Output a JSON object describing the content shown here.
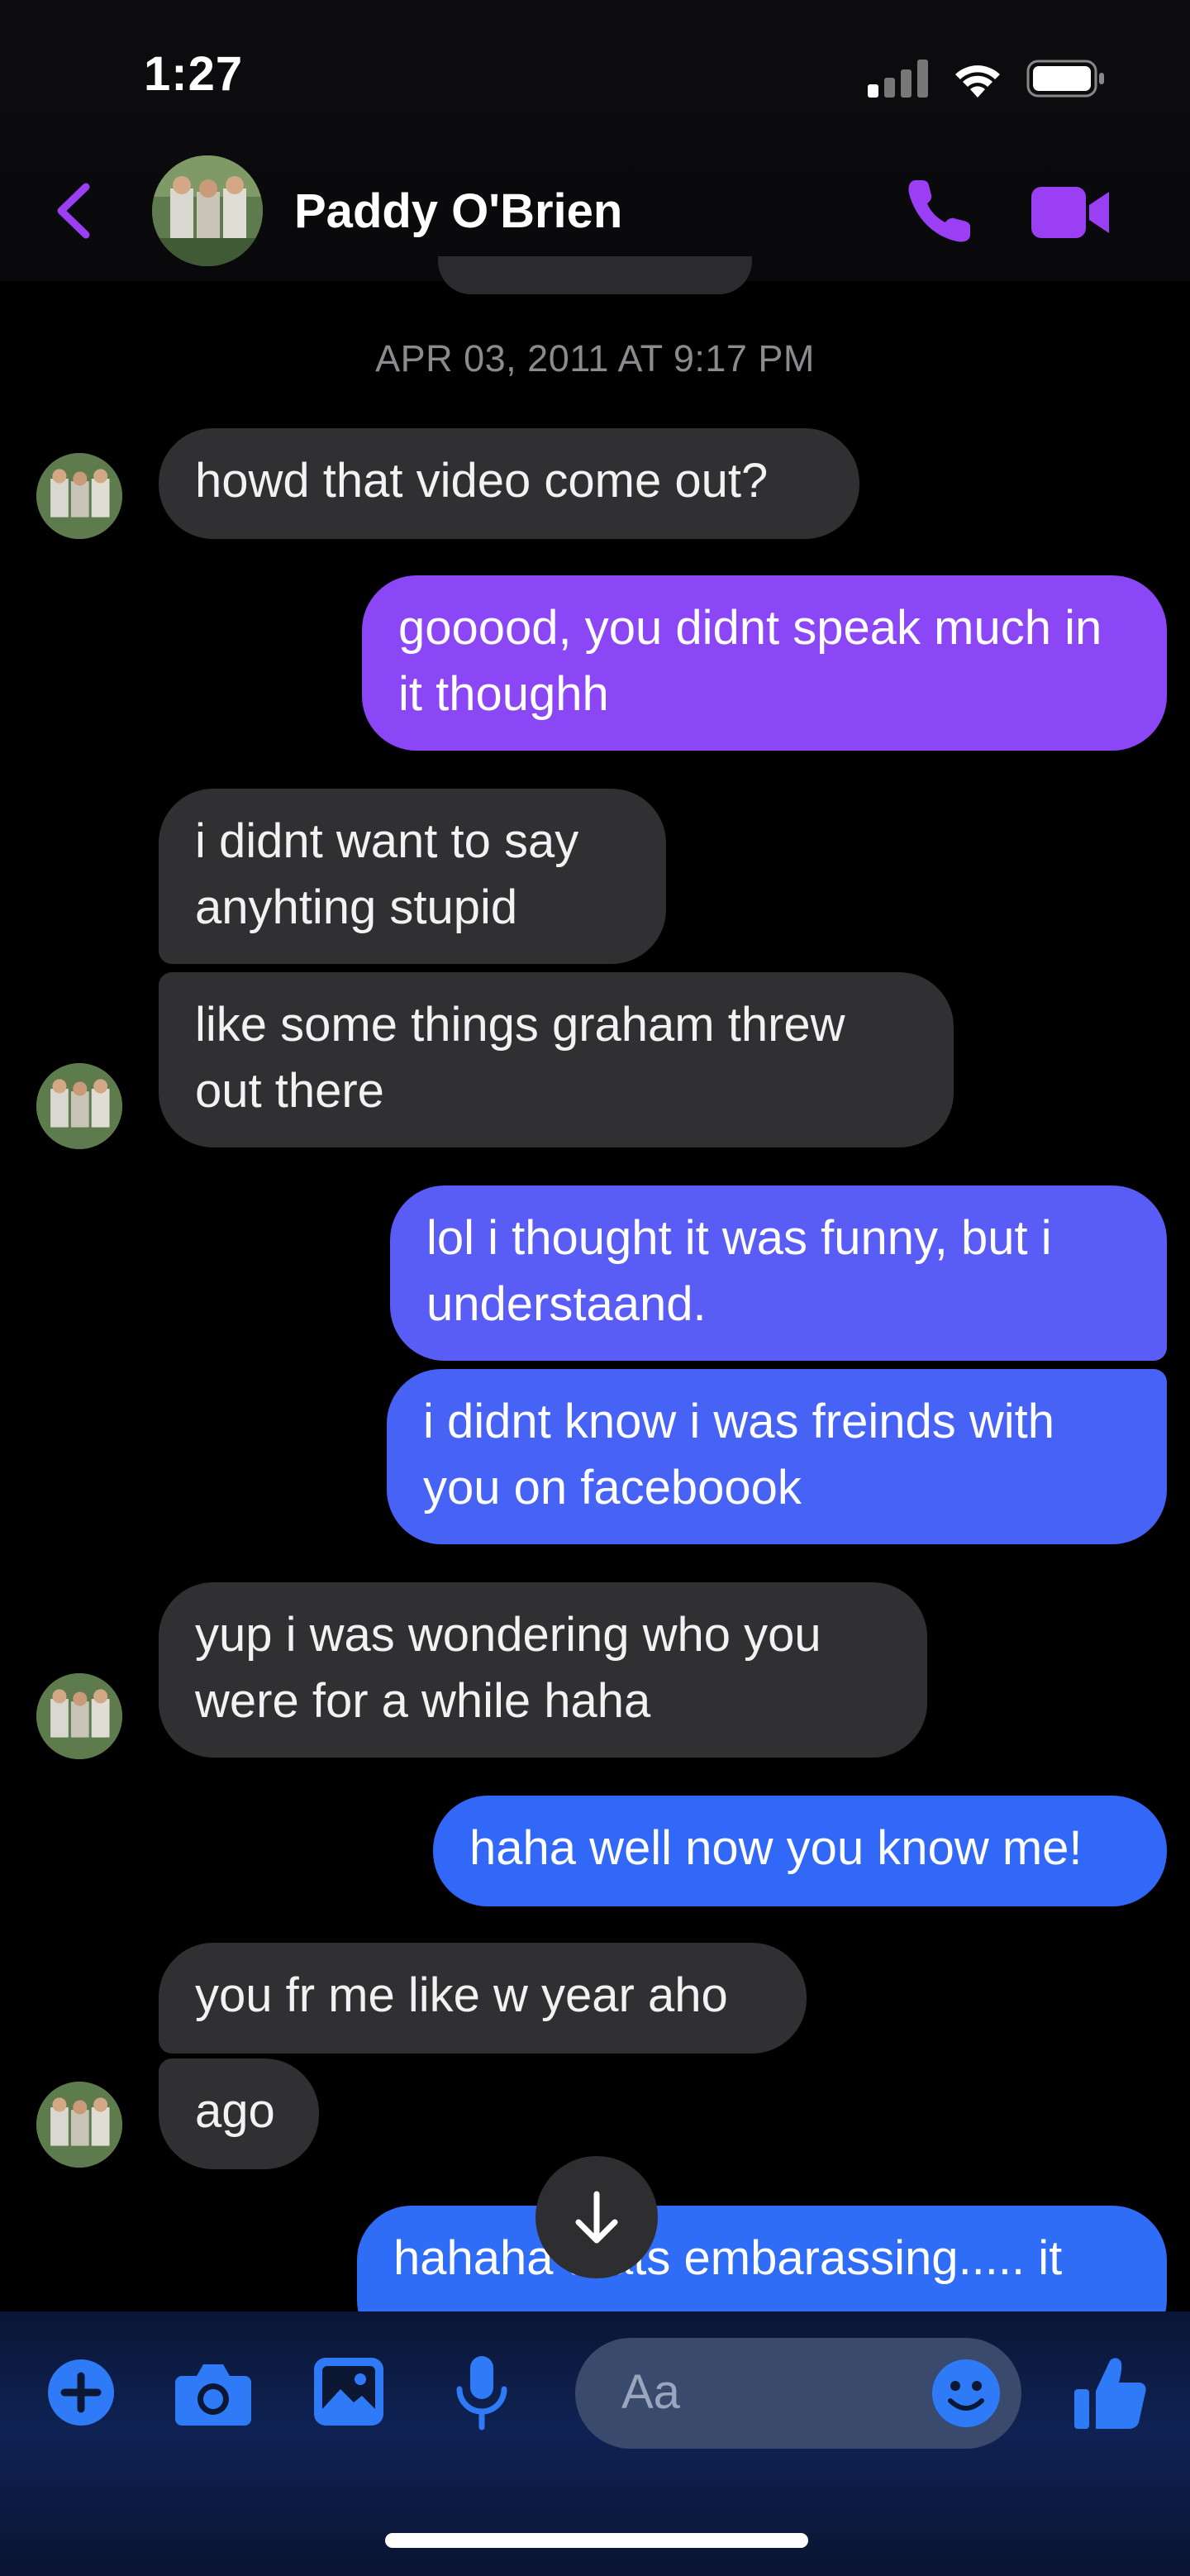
{
  "status_bar": {
    "time": "1:27"
  },
  "header": {
    "contact_name": "Paddy O'Brien"
  },
  "conversation": {
    "timestamp": "APR 03, 2011 AT 9:17 PM",
    "messages": [
      {
        "text": "howd that video come out?"
      },
      {
        "text": "gooood, you didnt speak much in it thoughh"
      },
      {
        "text": "i didnt want to say anyhting stupid"
      },
      {
        "text": "like some things graham threw out there"
      },
      {
        "text": "lol i thought it was funny, but i understaand."
      },
      {
        "text": "i didnt know i was freinds with you on faceboook"
      },
      {
        "text": "yup i was wondering who you were for a while haha"
      },
      {
        "text": "haha well now you know me!"
      },
      {
        "text": "you fr me like w year aho"
      },
      {
        "text": "ago"
      },
      {
        "text": "hahaha thats embarassing..... it"
      }
    ]
  },
  "composer": {
    "placeholder": "Aa"
  },
  "colors": {
    "accent": "#9b3ff5",
    "outgoing_top": "#8a47f6",
    "outgoing_mid": "#5b5cf6",
    "outgoing_bottom": "#2f6df7",
    "incoming": "#303033"
  }
}
